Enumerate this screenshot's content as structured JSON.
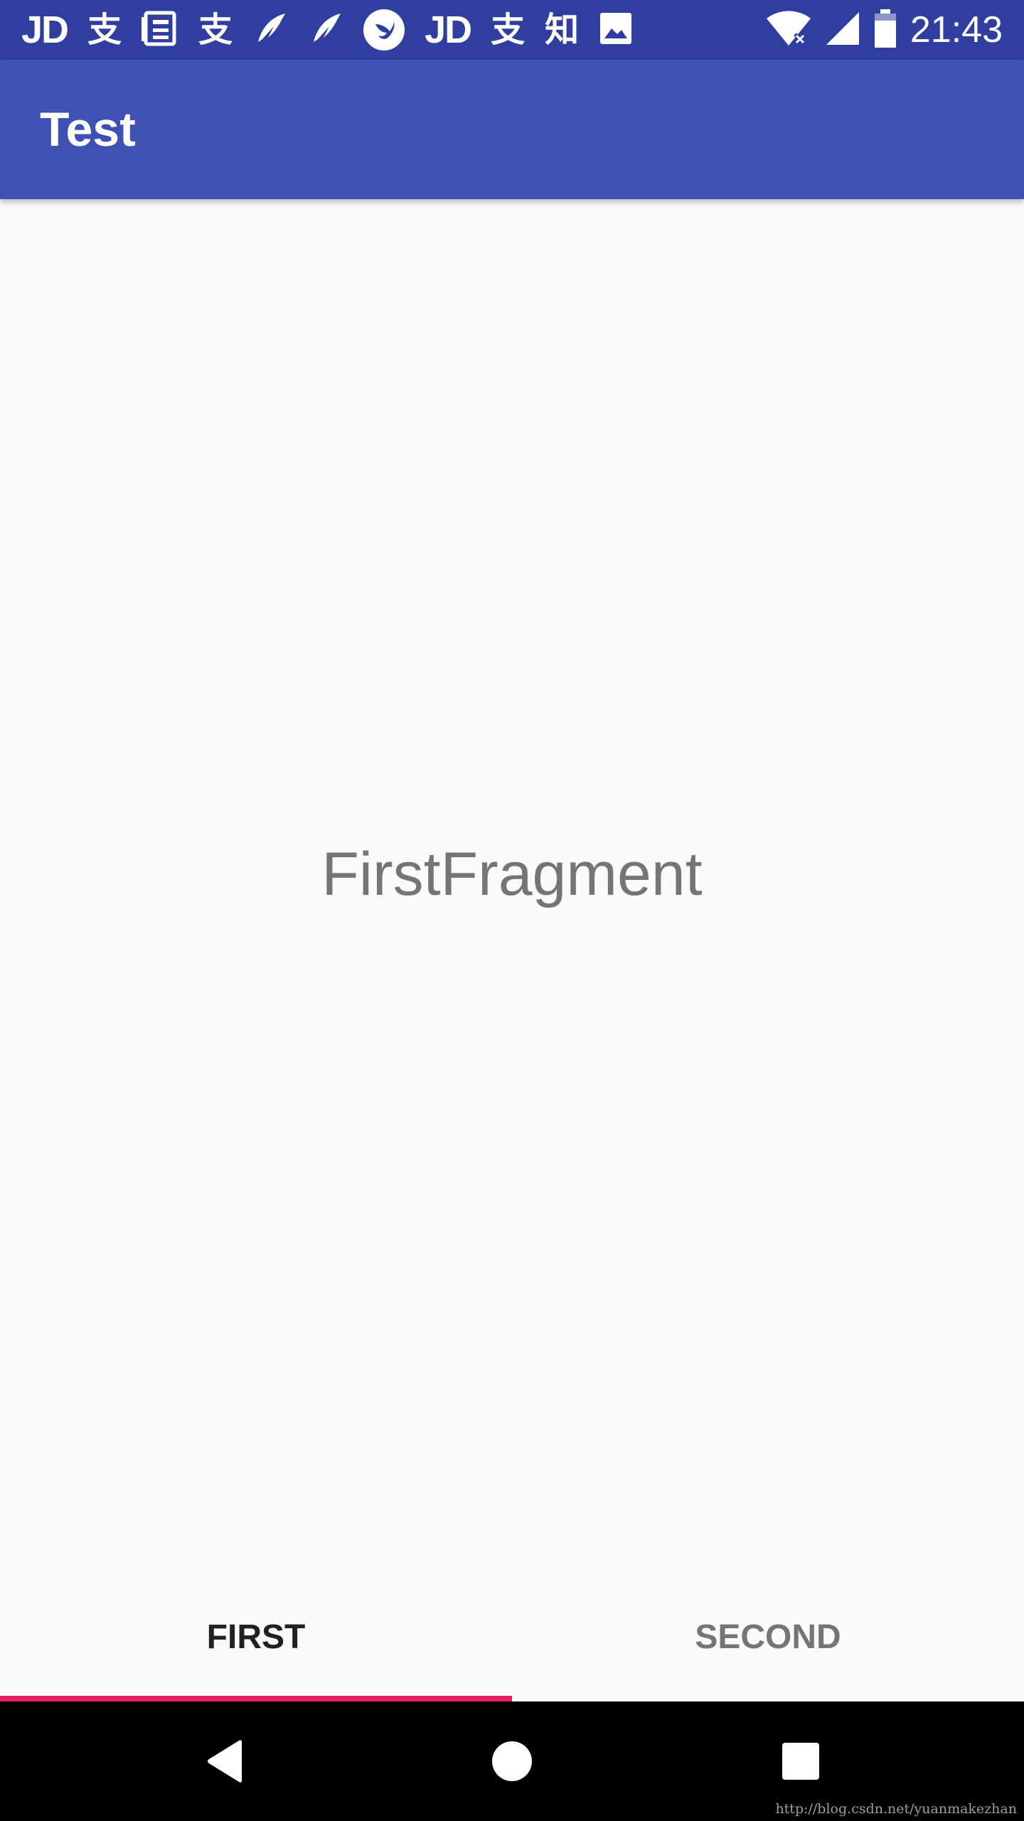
{
  "status_bar": {
    "time": "21:43",
    "notification_icons": [
      {
        "name": "jd-icon",
        "glyph": "JD"
      },
      {
        "name": "alipay-icon",
        "glyph": "支"
      },
      {
        "name": "news-icon",
        "glyph": "▤"
      },
      {
        "name": "alipay-icon",
        "glyph": "支"
      },
      {
        "name": "feather-icon",
        "glyph": "❦"
      },
      {
        "name": "feather-icon",
        "glyph": "❦"
      },
      {
        "name": "bird-icon",
        "glyph": ""
      },
      {
        "name": "jd-icon",
        "glyph": "JD"
      },
      {
        "name": "alipay-icon",
        "glyph": "支"
      },
      {
        "name": "zhihu-icon",
        "glyph": "知"
      },
      {
        "name": "image-icon",
        "glyph": ""
      }
    ],
    "system_icons": [
      "wifi-icon",
      "signal-icon",
      "battery-icon"
    ]
  },
  "app_bar": {
    "title": "Test",
    "color": "#3F51B5",
    "status_color": "#303F9F"
  },
  "content": {
    "fragment_text": "FirstFragment"
  },
  "tabs": [
    {
      "label": "FIRST",
      "selected": true
    },
    {
      "label": "SECOND",
      "selected": false
    }
  ],
  "indicator_color": "#E91E63",
  "nav_bar": {
    "buttons": [
      "back-icon",
      "home-icon",
      "recents-icon"
    ]
  },
  "watermark": "http://blog.csdn.net/yuanmakezhan"
}
